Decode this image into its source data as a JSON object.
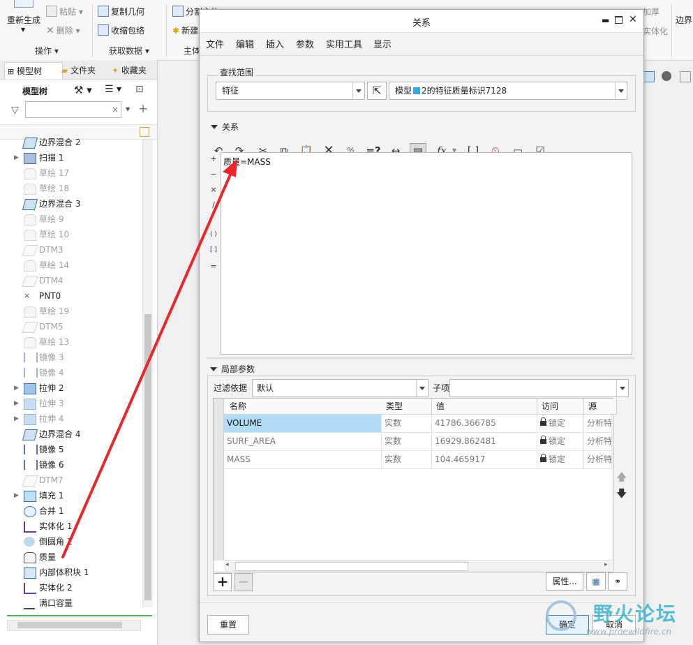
{
  "ribbon": {
    "regenerate": "重新生成",
    "paste": "粘贴",
    "delete": "删除",
    "copy_geometry": "复制几何",
    "shrinkwrap": "收缩包络",
    "split": "分割主体",
    "new": "新建",
    "thicken": "加厚",
    "solidify": "实体化",
    "boundary": "边界",
    "group_operations": "操作",
    "group_get_data": "获取数据",
    "group_body": "主体"
  },
  "left_panel": {
    "tabs": [
      "模型树",
      "文件夹",
      "收藏夹"
    ],
    "model_tree_label": "模型树",
    "search_placeholder": "",
    "tree_items": [
      {
        "label": "边界混合 2",
        "dim": false,
        "expand": false,
        "icon": "boundary-blend"
      },
      {
        "label": "扫描 1",
        "dim": false,
        "expand": true,
        "icon": "sweep"
      },
      {
        "label": "草绘 17",
        "dim": true,
        "expand": false,
        "icon": "sketch"
      },
      {
        "label": "草绘 18",
        "dim": true,
        "expand": false,
        "icon": "sketch"
      },
      {
        "label": "边界混合 3",
        "dim": false,
        "expand": false,
        "icon": "boundary-blend"
      },
      {
        "label": "草绘 9",
        "dim": true,
        "expand": false,
        "icon": "sketch"
      },
      {
        "label": "草绘 10",
        "dim": true,
        "expand": false,
        "icon": "sketch"
      },
      {
        "label": "DTM3",
        "dim": true,
        "expand": false,
        "icon": "datum-plane"
      },
      {
        "label": "草绘 14",
        "dim": true,
        "expand": false,
        "icon": "sketch"
      },
      {
        "label": "DTM4",
        "dim": true,
        "expand": false,
        "icon": "datum-plane"
      },
      {
        "label": "PNT0",
        "dim": false,
        "expand": false,
        "icon": "datum-point"
      },
      {
        "label": "草绘 19",
        "dim": true,
        "expand": false,
        "icon": "sketch"
      },
      {
        "label": "DTM5",
        "dim": true,
        "expand": false,
        "icon": "datum-plane"
      },
      {
        "label": "草绘 13",
        "dim": true,
        "expand": false,
        "icon": "sketch"
      },
      {
        "label": "镜像 3",
        "dim": true,
        "expand": false,
        "icon": "mirror"
      },
      {
        "label": "镜像 4",
        "dim": true,
        "expand": false,
        "icon": "mirror"
      },
      {
        "label": "拉伸 2",
        "dim": false,
        "expand": true,
        "icon": "extrude"
      },
      {
        "label": "拉伸 3",
        "dim": true,
        "expand": true,
        "icon": "extrude"
      },
      {
        "label": "拉伸 4",
        "dim": true,
        "expand": true,
        "icon": "extrude"
      },
      {
        "label": "边界混合 4",
        "dim": false,
        "expand": false,
        "icon": "boundary-blend"
      },
      {
        "label": "镜像 5",
        "dim": false,
        "expand": false,
        "icon": "mirror"
      },
      {
        "label": "镜像 6",
        "dim": false,
        "expand": false,
        "icon": "mirror"
      },
      {
        "label": "DTM7",
        "dim": true,
        "expand": false,
        "icon": "datum-plane"
      },
      {
        "label": "填充 1",
        "dim": false,
        "expand": true,
        "icon": "fill"
      },
      {
        "label": "合并 1",
        "dim": false,
        "expand": false,
        "icon": "merge"
      },
      {
        "label": "实体化 1",
        "dim": false,
        "expand": false,
        "icon": "solidify"
      },
      {
        "label": "倒圆角 1",
        "dim": false,
        "expand": false,
        "icon": "round"
      },
      {
        "label": "质量",
        "dim": false,
        "expand": false,
        "icon": "mass"
      },
      {
        "label": "内部体积块 1",
        "dim": false,
        "expand": false,
        "icon": "volume"
      },
      {
        "label": "实体化 2",
        "dim": false,
        "expand": false,
        "icon": "solidify"
      },
      {
        "label": "满口容量",
        "dim": false,
        "expand": false,
        "icon": "capacity"
      }
    ]
  },
  "dialog": {
    "title": "关系",
    "menu": [
      "文件",
      "编辑",
      "插入",
      "参数",
      "实用工具",
      "显示"
    ],
    "lookup_label": "查找范围",
    "lookup_type": "特征",
    "lookup_target_prefix": "模型",
    "lookup_target": "2的特征质量标识7128",
    "relations_label": "关系",
    "relation_text": "质量=MASS",
    "operators": [
      "+",
      "−",
      "×",
      "/",
      "( )",
      "[ ]",
      "="
    ],
    "local_params_label": "局部参数",
    "filter_label": "过滤依据",
    "filter_value": "默认",
    "subitem_label": "子项",
    "subitem_value": "",
    "columns": [
      "名称",
      "类型",
      "值",
      "访问",
      "源"
    ],
    "rows": [
      {
        "name": "VOLUME",
        "type": "实数",
        "value": "41786.366785",
        "access": "锁定",
        "source": "分析特"
      },
      {
        "name": "SURF_AREA",
        "type": "实数",
        "value": "16929.862481",
        "access": "锁定",
        "source": "分析特"
      },
      {
        "name": "MASS",
        "type": "实数",
        "value": "104.465917",
        "access": "锁定",
        "source": "分析特"
      }
    ],
    "properties_button": "属性...",
    "reset_button": "重置",
    "ok_button": "确定",
    "cancel_button": "取消"
  },
  "watermark": {
    "title": "野火论坛",
    "url": "www.proewildfire.cn"
  },
  "colors": {
    "accent": "#b3dcf7",
    "arrow": "#e8262b",
    "tree_active_line": "#44b549"
  }
}
